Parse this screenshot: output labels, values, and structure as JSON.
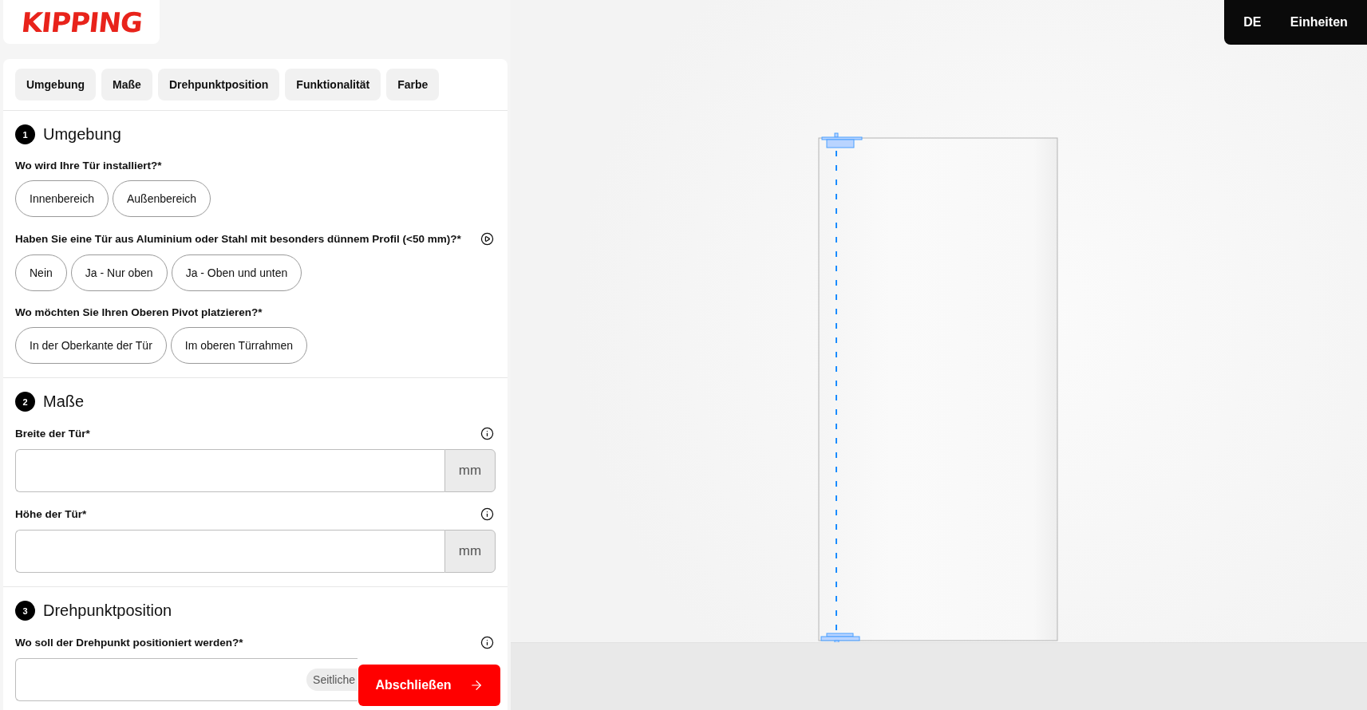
{
  "logo": {
    "text": "KIPPING"
  },
  "header": {
    "language": "DE",
    "units": "Einheiten"
  },
  "tabs": [
    {
      "label": "Umgebung"
    },
    {
      "label": "Maße"
    },
    {
      "label": "Drehpunktposition"
    },
    {
      "label": "Funktionalität"
    },
    {
      "label": "Farbe"
    }
  ],
  "sections": [
    {
      "number": "1",
      "title": "Umgebung",
      "questions": [
        {
          "kind": "options",
          "label": "Wo wird Ihre Tür installiert?*",
          "options": [
            "Innenbereich",
            "Außenbereich"
          ]
        },
        {
          "kind": "options",
          "label": "Haben Sie eine Tür aus Aluminium oder Stahl mit besonders dünnem Profil (<50 mm)?*",
          "help": {
            "kind": "video"
          },
          "options": [
            "Nein",
            "Ja - Nur oben",
            "Ja - Oben und unten"
          ]
        },
        {
          "kind": "options",
          "label": "Wo möchten Sie Ihren Oberen Pivot platzieren?*",
          "options": [
            "In der Oberkante der Tür",
            "Im oberen Türrahmen"
          ]
        }
      ]
    },
    {
      "number": "2",
      "title": "Maße",
      "questions": [
        {
          "kind": "measure",
          "label": "Breite der Tür*",
          "help": {
            "kind": "info"
          },
          "unit": "mm"
        },
        {
          "kind": "measure",
          "label": "Höhe der Tür*",
          "help": {
            "kind": "info"
          },
          "unit": "mm"
        }
      ]
    },
    {
      "number": "3",
      "title": "Drehpunktposition",
      "questions": [
        {
          "kind": "select",
          "label": "Wo soll der Drehpunkt positioniert werden?*",
          "help": {
            "kind": "info"
          },
          "chip": "Seitliche"
        }
      ]
    }
  ],
  "submit": {
    "label": "Abschließen"
  }
}
